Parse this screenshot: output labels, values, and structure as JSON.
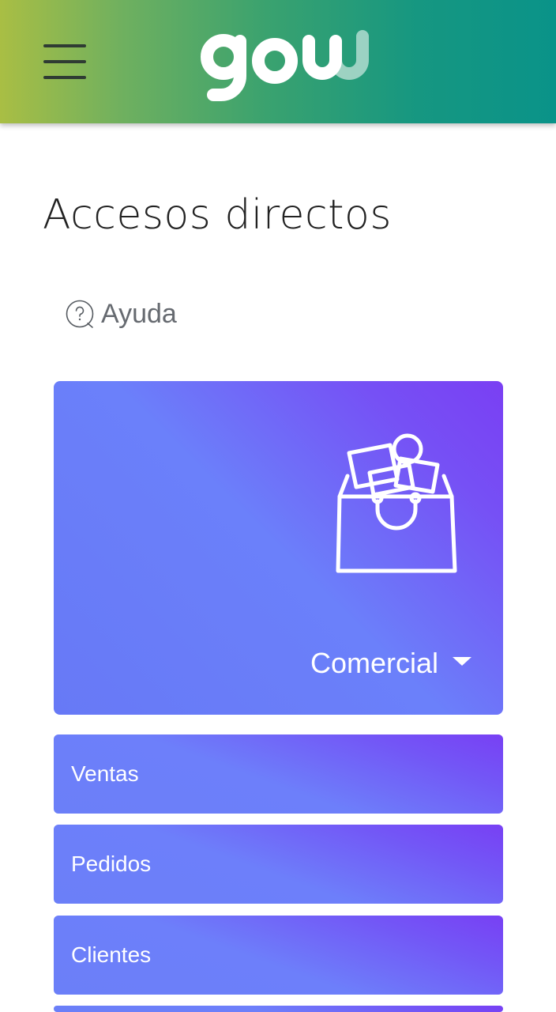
{
  "header": {
    "menu_icon": "hamburger-menu-icon",
    "logo_text": "gow",
    "colors": {
      "gradient_start": "#a9be44",
      "gradient_end": "#0a9389"
    }
  },
  "page": {
    "title": "Accesos directos"
  },
  "help": {
    "icon": "question-circle-icon",
    "label": "Ayuda"
  },
  "section_card": {
    "icon": "shopping-bag-icon",
    "label": "Comercial",
    "toggle_icon": "caret-down-icon",
    "colors": {
      "gradient_start": "#6779f6",
      "gradient_end": "#7a3ff3"
    }
  },
  "items": [
    {
      "label": "Ventas"
    },
    {
      "label": "Pedidos"
    },
    {
      "label": "Clientes"
    }
  ]
}
